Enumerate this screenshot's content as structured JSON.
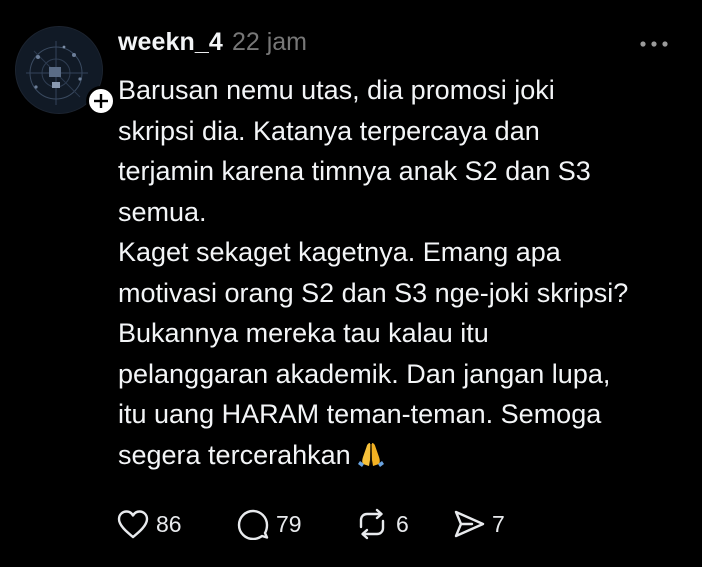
{
  "post": {
    "username": "weekn_4",
    "time": "22 jam",
    "body_lines": [
      "Barusan nemu utas, dia promosi joki",
      "skripsi dia. Katanya terpercaya dan",
      "terjamin karena timnya anak S2 dan S3",
      "semua.",
      "Kaget sekaget kagetnya. Emang apa",
      "motivasi orang S2 dan S3 nge-joki skripsi?",
      "Bukannya mereka tau kalau itu",
      "pelanggaran akademik. Dan jangan lupa,",
      "itu uang HARAM teman-teman. Semoga",
      "segera tercerahkan"
    ],
    "trailing_emoji": "folded-hands-emoji"
  },
  "actions": {
    "likes": "86",
    "replies": "79",
    "reposts": "6",
    "shares": "7"
  },
  "icons": {
    "avatar": "avatar-image",
    "follow": "plus-icon",
    "more": "more-dots-icon",
    "like": "heart-icon",
    "reply": "comment-icon",
    "repost": "repost-icon",
    "share": "send-icon"
  },
  "colors": {
    "background": "#000000",
    "text": "#f3f5f7",
    "muted": "#777777"
  }
}
